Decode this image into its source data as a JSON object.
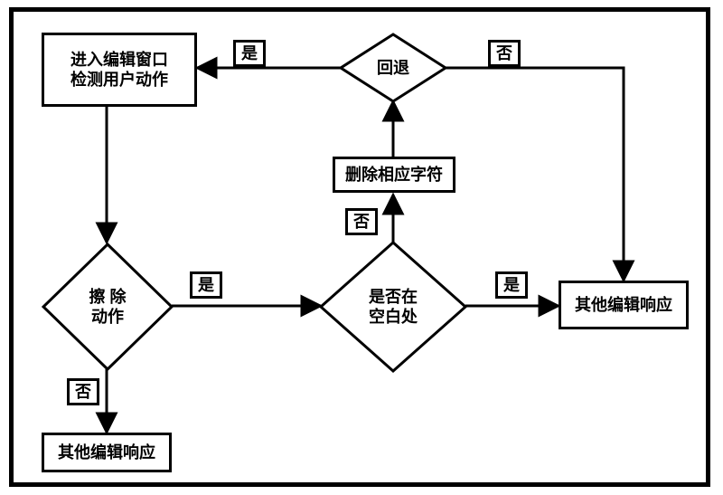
{
  "chart_data": {
    "type": "diagram",
    "title": "",
    "nodes": [
      {
        "id": "start",
        "kind": "process",
        "label": "进入编辑窗口\n检测用户动作"
      },
      {
        "id": "eraseQ",
        "kind": "decision",
        "label": "擦 除\n动作"
      },
      {
        "id": "blankQ",
        "kind": "decision",
        "label": "是否在\n空白处"
      },
      {
        "id": "deleteChar",
        "kind": "process",
        "label": "删除相应字符"
      },
      {
        "id": "returnQ",
        "kind": "decision",
        "label": "回退"
      },
      {
        "id": "otherRespR",
        "kind": "process",
        "label": "其他编辑响应"
      },
      {
        "id": "otherRespB",
        "kind": "process",
        "label": "其他编辑响应"
      }
    ],
    "edges": [
      {
        "from": "start",
        "to": "eraseQ",
        "label": ""
      },
      {
        "from": "eraseQ",
        "to": "blankQ",
        "label": "是"
      },
      {
        "from": "eraseQ",
        "to": "otherRespB",
        "label": "否"
      },
      {
        "from": "blankQ",
        "to": "otherRespR",
        "label": "是"
      },
      {
        "from": "blankQ",
        "to": "deleteChar",
        "label": "否"
      },
      {
        "from": "deleteChar",
        "to": "returnQ",
        "label": ""
      },
      {
        "from": "returnQ",
        "to": "start",
        "label": "是"
      },
      {
        "from": "returnQ",
        "to": "otherRespR",
        "label": "否"
      }
    ],
    "edge_labels": {
      "yes": "是",
      "no": "否"
    }
  },
  "nodes": {
    "start": "进入编辑窗口\n检测用户动作",
    "eraseQ": "擦 除\n动作",
    "blankQ": "是否在\n空白处",
    "deleteChar": "删除相应字符",
    "returnQ": "回退",
    "otherRespR": "其他编辑响应",
    "otherRespB": "其他编辑响应"
  },
  "labels": {
    "yes": "是",
    "no": "否"
  }
}
